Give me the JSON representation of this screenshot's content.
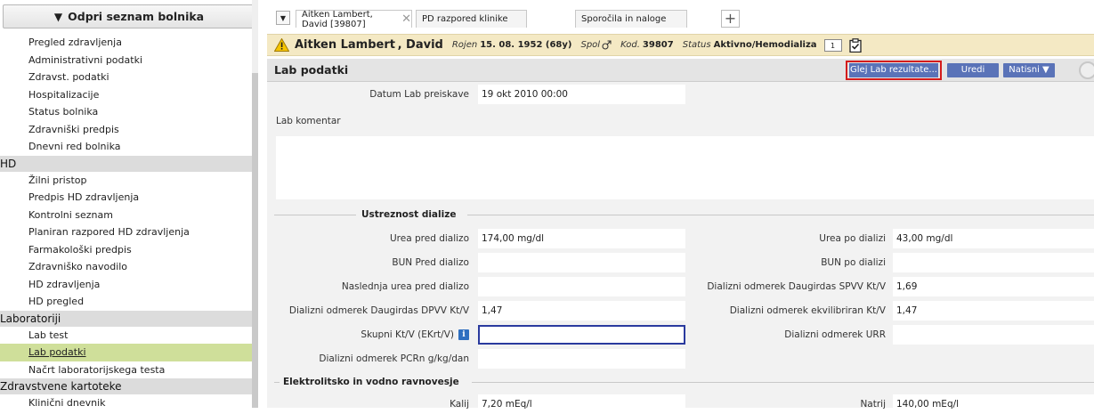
{
  "sidebar": {
    "open_button": "Odpri seznam bolnika",
    "items": [
      {
        "type": "item",
        "label": "Pregled zdravljenja"
      },
      {
        "type": "item",
        "label": "Administrativni podatki"
      },
      {
        "type": "item",
        "label": "Zdravst. podatki"
      },
      {
        "type": "item",
        "label": "Hospitalizacije"
      },
      {
        "type": "item",
        "label": "Status bolnika"
      },
      {
        "type": "item",
        "label": "Zdravniški predpis"
      },
      {
        "type": "item",
        "label": "Dnevni red bolnika"
      },
      {
        "type": "group",
        "label": "HD"
      },
      {
        "type": "item",
        "label": "Žilni pristop"
      },
      {
        "type": "item",
        "label": "Predpis HD zdravljenja"
      },
      {
        "type": "item",
        "label": "Kontrolni seznam"
      },
      {
        "type": "item",
        "label": "Planiran razpored HD zdravljenja"
      },
      {
        "type": "item",
        "label": "Farmakološki predpis"
      },
      {
        "type": "item",
        "label": "Zdravniško navodilo"
      },
      {
        "type": "item",
        "label": "HD zdravljenja"
      },
      {
        "type": "item",
        "label": "HD pregled"
      },
      {
        "type": "group",
        "label": "Laboratoriji"
      },
      {
        "type": "item",
        "label": "Lab test"
      },
      {
        "type": "item",
        "label": "Lab podatki",
        "active": true
      },
      {
        "type": "item",
        "label": "Načrt laboratorijskega testa"
      },
      {
        "type": "group",
        "label": "Zdravstvene kartoteke"
      },
      {
        "type": "item",
        "label": "Klinični dnevnik"
      }
    ]
  },
  "tabs": {
    "items": [
      "Aitken Lambert, David [39807]",
      "PD razpored klinike",
      "Sporočila in naloge"
    ],
    "close_symbol": "✕",
    "add_symbol": "+"
  },
  "patient": {
    "name": "Aitken Lambert , David",
    "born_label": "Rojen",
    "born_value": "15. 08. 1952 (68y)",
    "sex_label": "Spol",
    "code_label": "Kod.",
    "code_value": "39807",
    "status_label": "Status",
    "status_value": "Aktivno/Hemodializa",
    "box_label": "1"
  },
  "section": {
    "title": "Lab podatki",
    "results_button": "Glej Lab rezultate...",
    "edit_button": "Uredi",
    "print_button": "Natisni ▼"
  },
  "form": {
    "lab_date_label": "Datum Lab preiskave",
    "lab_date_value": "19 okt 2010 00:00",
    "comment_label": "Lab komentar",
    "comment_value": "",
    "dialysis_section": "Ustreznost dialize",
    "electrolyte_section": "Elektrolitsko in vodno ravnovesje",
    "left_fields": [
      {
        "label": "Urea pred dializo",
        "value": "174,00 mg/dl"
      },
      {
        "label": "BUN Pred dializo",
        "value": ""
      },
      {
        "label": "Naslednja urea pred dializo",
        "value": ""
      },
      {
        "label": "Dializni odmerek Daugirdas DPVV Kt/V",
        "value": "1,47"
      },
      {
        "label": "Skupni Kt/V (EKrt/V)",
        "value": ""
      },
      {
        "label": "Dializni odmerek PCRn g/kg/dan",
        "value": ""
      }
    ],
    "right_fields": [
      {
        "label": "Urea po dializi",
        "value": "43,00 mg/dl"
      },
      {
        "label": "BUN po dializi",
        "value": ""
      },
      {
        "label": "Dializni odmerek Daugirdas SPVV Kt/V",
        "value": "1,69"
      },
      {
        "label": "Dializni odmerek ekvilibriran Kt/V",
        "value": "1,47"
      },
      {
        "label": "Dializni odmerek URR",
        "value": ""
      }
    ],
    "electrolyte_left": {
      "label": "Kalij",
      "value": "7,20 mEq/l"
    },
    "electrolyte_right": {
      "label": "Natrij",
      "value": "140,00 mEq/l"
    }
  }
}
